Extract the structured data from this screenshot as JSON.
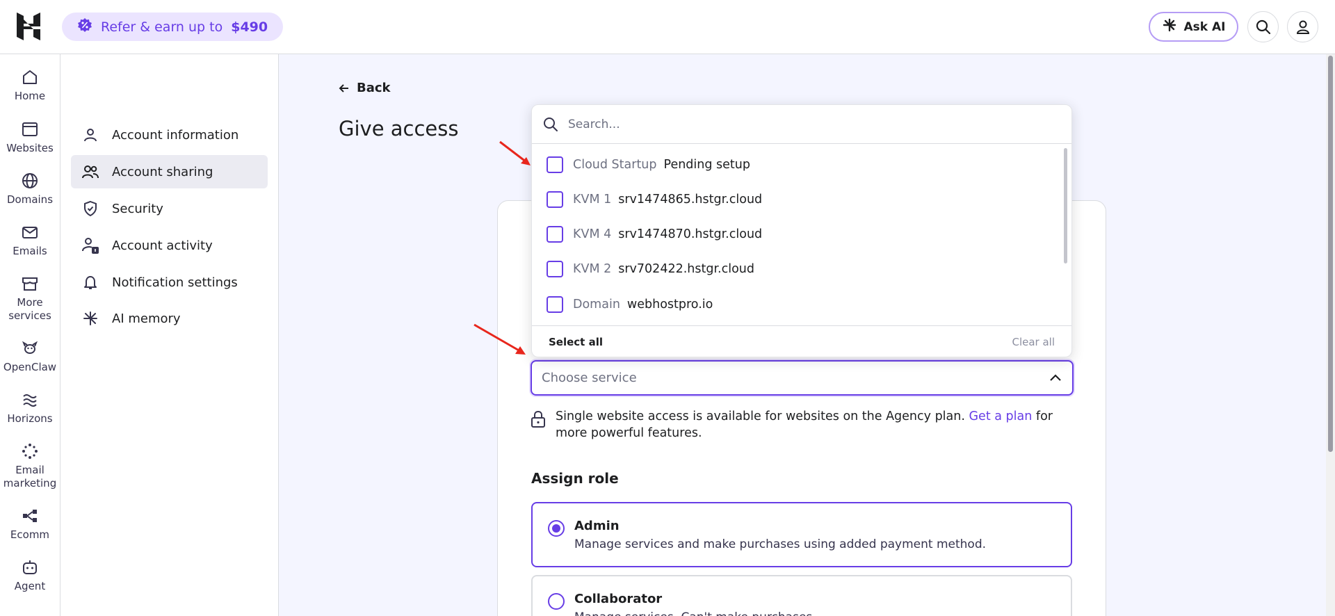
{
  "topbar": {
    "refer_label": "Refer & earn up to",
    "refer_amount": "$490",
    "ask_ai_label": "Ask AI"
  },
  "rail": [
    {
      "label": "Home",
      "icon": "home-icon"
    },
    {
      "label": "Websites",
      "icon": "browser-icon"
    },
    {
      "label": "Domains",
      "icon": "globe-icon"
    },
    {
      "label": "Emails",
      "icon": "mail-icon"
    },
    {
      "label": "More services",
      "icon": "store-icon"
    },
    {
      "label": "OpenClaw",
      "icon": "claw-icon"
    },
    {
      "label": "Horizons",
      "icon": "waves-icon"
    },
    {
      "label": "Email marketing",
      "icon": "spark-dots-icon"
    },
    {
      "label": "Ecomm",
      "icon": "nodes-icon"
    },
    {
      "label": "Agent",
      "icon": "robot-icon"
    }
  ],
  "subnav": [
    {
      "label": "Account information",
      "icon": "person-icon",
      "active": false
    },
    {
      "label": "Account sharing",
      "icon": "people-icon",
      "active": true
    },
    {
      "label": "Security",
      "icon": "shield-icon",
      "active": false
    },
    {
      "label": "Account activity",
      "icon": "person-activity-icon",
      "active": false
    },
    {
      "label": "Notification settings",
      "icon": "bell-icon",
      "active": false
    },
    {
      "label": "AI memory",
      "icon": "ai-spark-icon",
      "active": false
    }
  ],
  "main": {
    "back_label": "Back",
    "title": "Give access",
    "choose_placeholder": "Choose service",
    "notice_text": "Single website access is available for websites on the Agency plan.",
    "notice_link": "Get a plan",
    "notice_tail": "for more powerful features.",
    "assign_role_label": "Assign role",
    "roles": [
      {
        "name": "Admin",
        "desc": "Manage services and make purchases using added payment method.",
        "selected": true
      },
      {
        "name": "Collaborator",
        "desc": "Manage services. Can't make purchases.",
        "selected": false
      }
    ]
  },
  "dropdown": {
    "search_placeholder": "Search...",
    "options": [
      {
        "type": "Cloud Startup",
        "name": "Pending setup",
        "checked": false
      },
      {
        "type": "KVM 1",
        "name": "srv1474865.hstgr.cloud",
        "checked": false
      },
      {
        "type": "KVM 4",
        "name": "srv1474870.hstgr.cloud",
        "checked": false
      },
      {
        "type": "KVM 2",
        "name": "srv702422.hstgr.cloud",
        "checked": false
      },
      {
        "type": "Domain",
        "name": "webhostpro.io",
        "checked": false
      }
    ],
    "select_all_label": "Select all",
    "clear_all_label": "Clear all"
  },
  "colors": {
    "accent": "#673de6",
    "annotation_arrow": "#e8261c"
  }
}
